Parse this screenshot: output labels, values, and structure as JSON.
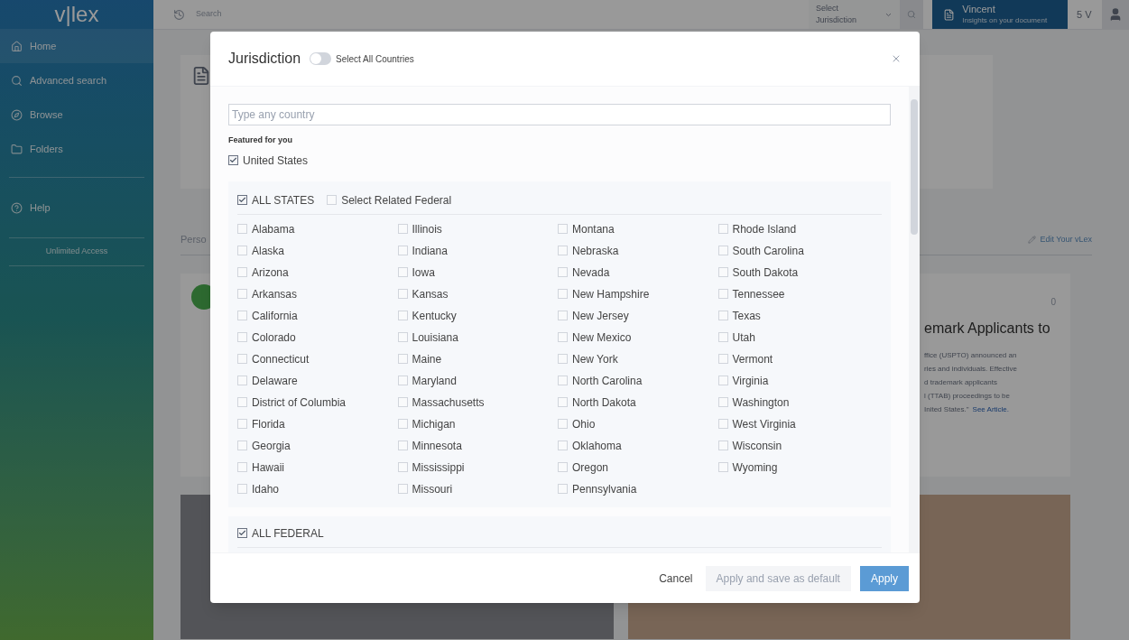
{
  "sidebar": {
    "logo": "v|lex",
    "items": [
      {
        "label": "Home",
        "selected": true
      },
      {
        "label": "Advanced search",
        "selected": false
      },
      {
        "label": "Browse",
        "selected": false
      },
      {
        "label": "Folders",
        "selected": false
      }
    ],
    "help": {
      "label": "Help",
      "selected": false
    },
    "access_label": "Unlimited Access"
  },
  "topbar": {
    "search_placeholder": "Search",
    "jurisdiction": "Select Jurisdiction",
    "user_name": "Vincent",
    "user_subtitle": "Insights on your document",
    "badge": "5 V"
  },
  "page": {
    "tab_label": "Perso",
    "edit_link": "Edit Your vLex",
    "card_count": "0",
    "card_title": "emark Applicants to",
    "card_lines": [
      "ffice (USPTO) announced an",
      "ries and individuals. Effective",
      "d trademark applicants",
      "l (TTAB) proceedings to be"
    ],
    "card_last_line": "Inited States.\"",
    "card_link": "See Article."
  },
  "modal": {
    "title": "Jurisdiction",
    "select_all": {
      "label": "Select All Countries",
      "on": false
    },
    "search_placeholder": "Type any country",
    "featured_label": "Featured for you",
    "featured": [
      {
        "name": "United States",
        "checked": true
      }
    ],
    "states_group": {
      "all": {
        "label": "ALL STATES",
        "checked": true
      },
      "related": {
        "label": "Select Related Federal",
        "checked": false
      },
      "items": [
        {
          "name": "Alabama",
          "checked": false
        },
        {
          "name": "Alaska",
          "checked": false
        },
        {
          "name": "Arizona",
          "checked": false
        },
        {
          "name": "Arkansas",
          "checked": false
        },
        {
          "name": "California",
          "checked": false
        },
        {
          "name": "Colorado",
          "checked": false
        },
        {
          "name": "Connecticut",
          "checked": false
        },
        {
          "name": "Delaware",
          "checked": false
        },
        {
          "name": "District of Columbia",
          "checked": false
        },
        {
          "name": "Florida",
          "checked": false
        },
        {
          "name": "Georgia",
          "checked": false
        },
        {
          "name": "Hawaii",
          "checked": false
        },
        {
          "name": "Idaho",
          "checked": false
        },
        {
          "name": "Illinois",
          "checked": false
        },
        {
          "name": "Indiana",
          "checked": false
        },
        {
          "name": "Iowa",
          "checked": false
        },
        {
          "name": "Kansas",
          "checked": false
        },
        {
          "name": "Kentucky",
          "checked": false
        },
        {
          "name": "Louisiana",
          "checked": false
        },
        {
          "name": "Maine",
          "checked": false
        },
        {
          "name": "Maryland",
          "checked": false
        },
        {
          "name": "Massachusetts",
          "checked": false
        },
        {
          "name": "Michigan",
          "checked": false
        },
        {
          "name": "Minnesota",
          "checked": false
        },
        {
          "name": "Mississippi",
          "checked": false
        },
        {
          "name": "Missouri",
          "checked": false
        },
        {
          "name": "Montana",
          "checked": false
        },
        {
          "name": "Nebraska",
          "checked": false
        },
        {
          "name": "Nevada",
          "checked": false
        },
        {
          "name": "New Hampshire",
          "checked": false
        },
        {
          "name": "New Jersey",
          "checked": false
        },
        {
          "name": "New Mexico",
          "checked": false
        },
        {
          "name": "New York",
          "checked": false
        },
        {
          "name": "North Carolina",
          "checked": false
        },
        {
          "name": "North Dakota",
          "checked": false
        },
        {
          "name": "Ohio",
          "checked": false
        },
        {
          "name": "Oklahoma",
          "checked": false
        },
        {
          "name": "Oregon",
          "checked": false
        },
        {
          "name": "Pennsylvania",
          "checked": false
        },
        {
          "name": "Rhode Island",
          "checked": false
        },
        {
          "name": "South Carolina",
          "checked": false
        },
        {
          "name": "South Dakota",
          "checked": false
        },
        {
          "name": "Tennessee",
          "checked": false
        },
        {
          "name": "Texas",
          "checked": false
        },
        {
          "name": "Utah",
          "checked": false
        },
        {
          "name": "Vermont",
          "checked": false
        },
        {
          "name": "Virginia",
          "checked": false
        },
        {
          "name": "Washington",
          "checked": false
        },
        {
          "name": "West Virginia",
          "checked": false
        },
        {
          "name": "Wisconsin",
          "checked": false
        },
        {
          "name": "Wyoming",
          "checked": false
        }
      ]
    },
    "federal_group": {
      "all": {
        "label": "ALL FEDERAL",
        "checked": true
      }
    },
    "buttons": [
      {
        "label": "Cancel",
        "kind": "link"
      },
      {
        "label": "Apply and save as default",
        "kind": "secondary"
      },
      {
        "label": "Apply",
        "kind": "primary"
      }
    ]
  }
}
